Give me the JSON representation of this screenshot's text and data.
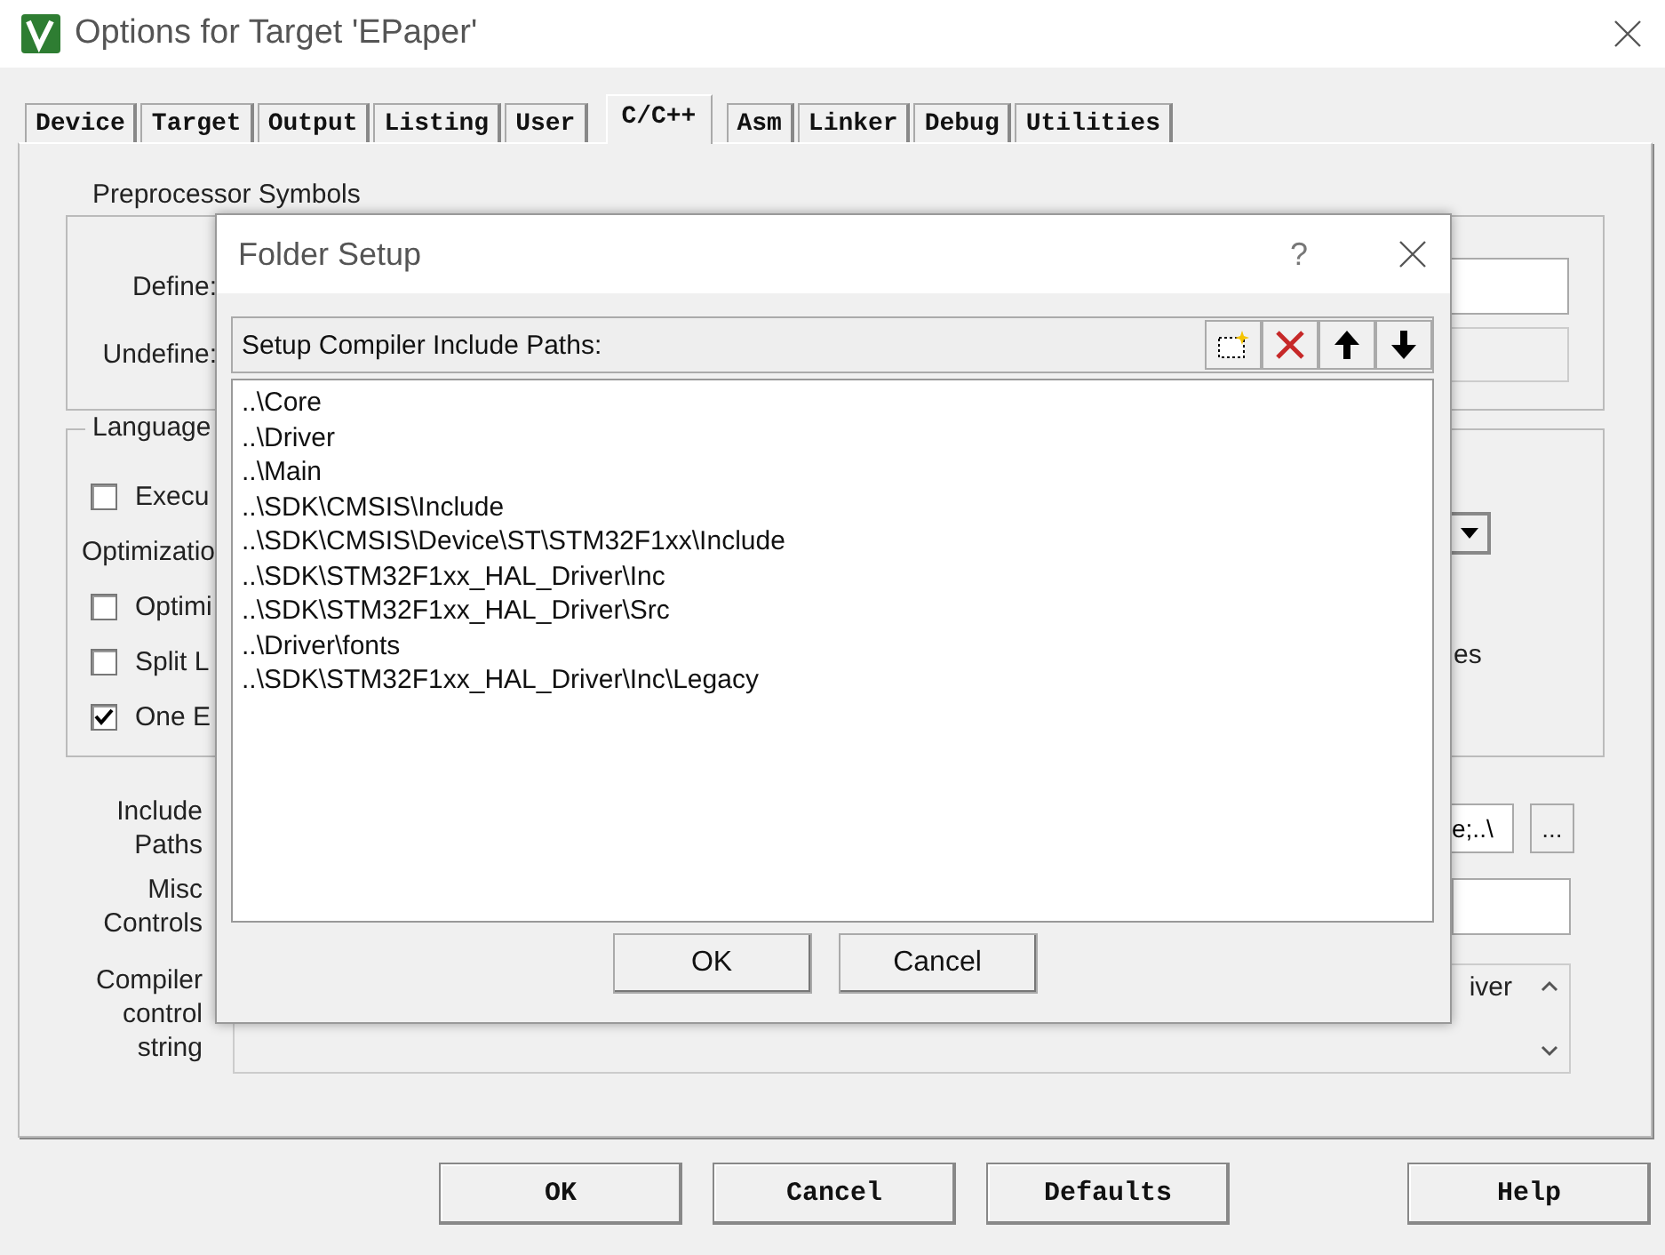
{
  "window": {
    "title": "Options for Target 'EPaper'"
  },
  "tabs": [
    {
      "label": "Device",
      "selected": false
    },
    {
      "label": "Target",
      "selected": false
    },
    {
      "label": "Output",
      "selected": false
    },
    {
      "label": "Listing",
      "selected": false
    },
    {
      "label": "User",
      "selected": false
    },
    {
      "label": "C/C++",
      "selected": true
    },
    {
      "label": "Asm",
      "selected": false
    },
    {
      "label": "Linker",
      "selected": false
    },
    {
      "label": "Debug",
      "selected": false
    },
    {
      "label": "Utilities",
      "selected": false
    }
  ],
  "preprocessor": {
    "title": "Preprocessor Symbols",
    "define_label": "Define:",
    "undefine_label": "Undefine:"
  },
  "language": {
    "title": "Language",
    "items": [
      {
        "kind": "checkbox",
        "label": "Execu",
        "checked": false
      },
      {
        "kind": "label",
        "label": "Optimizatio"
      },
      {
        "kind": "checkbox",
        "label": "Optimi",
        "checked": false
      },
      {
        "kind": "checkbox",
        "label": "Split L",
        "checked": false
      },
      {
        "kind": "checkbox",
        "label": "One E",
        "checked": true
      }
    ],
    "right_text": "es"
  },
  "include_paths": {
    "label": "Include Paths",
    "value": "e;..\\",
    "browse": "..."
  },
  "misc_controls": {
    "label": "Misc Controls"
  },
  "compiler_string": {
    "label": "Compiler control string",
    "value": "iver"
  },
  "buttons": [
    "OK",
    "Cancel",
    "Defaults",
    "Help"
  ],
  "folder_dialog": {
    "title": "Folder Setup",
    "help": "?",
    "heading": "Setup Compiler Include Paths:",
    "paths": [
      "..\\Core",
      "..\\Driver",
      "..\\Main",
      "..\\SDK\\CMSIS\\Include",
      "..\\SDK\\CMSIS\\Device\\ST\\STM32F1xx\\Include",
      "..\\SDK\\STM32F1xx_HAL_Driver\\Inc",
      "..\\SDK\\STM32F1xx_HAL_Driver\\Src",
      "..\\Driver\\fonts",
      "..\\SDK\\STM32F1xx_HAL_Driver\\Inc\\Legacy"
    ],
    "buttons": [
      "OK",
      "Cancel"
    ]
  }
}
